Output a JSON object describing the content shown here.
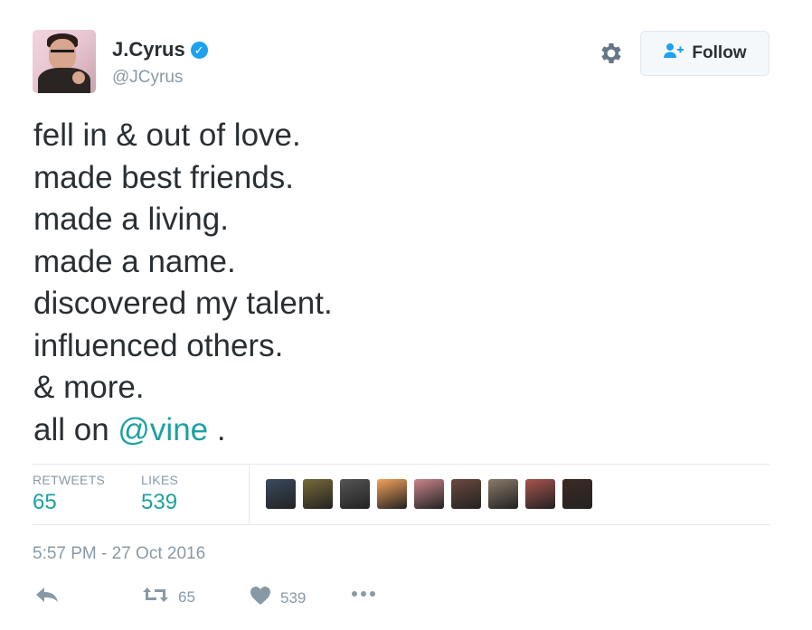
{
  "user": {
    "name": "J.Cyrus",
    "handle": "@JCyrus",
    "verified": true
  },
  "follow_button": {
    "label": "Follow"
  },
  "tweet": {
    "lines": [
      "fell in & out of love.",
      "made best friends.",
      "made a living.",
      "made a name.",
      "discovered my talent.",
      "influenced others.",
      "& more."
    ],
    "last_line_prefix": "all on ",
    "mention": "@vine",
    "last_line_suffix": " ."
  },
  "stats": {
    "retweets_label": "RETWEETS",
    "retweets_value": "65",
    "likes_label": "LIKES",
    "likes_value": "539"
  },
  "likers": [
    {
      "name": "liker-1",
      "color": "#3b4a5e"
    },
    {
      "name": "liker-2",
      "color": "#7a6a3a"
    },
    {
      "name": "liker-3",
      "color": "#555555"
    },
    {
      "name": "liker-4",
      "color": "#f3a25b"
    },
    {
      "name": "liker-5",
      "color": "#c9858c"
    },
    {
      "name": "liker-6",
      "color": "#6b4a3e"
    },
    {
      "name": "liker-7",
      "color": "#8a7a6a"
    },
    {
      "name": "liker-8",
      "color": "#a8544f"
    },
    {
      "name": "liker-9",
      "color": "#3e2a24"
    }
  ],
  "timestamp": "5:57 PM - 27 Oct 2016",
  "actions": {
    "reply_icon": "reply-icon",
    "retweet_icon": "retweet-icon",
    "retweet_count": "65",
    "like_icon": "heart-icon",
    "like_count": "539",
    "more_icon": "more-icon"
  },
  "colors": {
    "accent": "#1da1a0",
    "muted": "#8899a6",
    "verified": "#1da1f2",
    "text": "#292f33"
  }
}
